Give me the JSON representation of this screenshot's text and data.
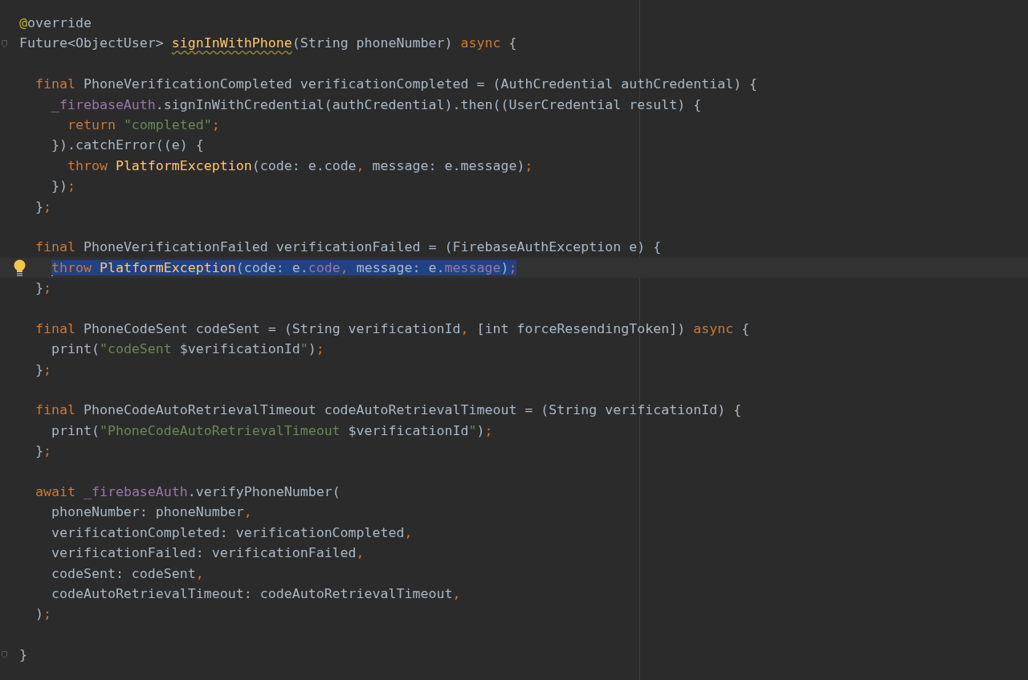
{
  "editor": {
    "lines": [
      {
        "kind": "code",
        "tokens": [
          {
            "kind": "annotation",
            "text": "@"
          },
          {
            "kind": "plain",
            "text": "override"
          }
        ]
      },
      {
        "kind": "fold",
        "tokens": [
          {
            "kind": "plain",
            "text": "Future<ObjectUser> "
          },
          {
            "kind": "warning",
            "text": "signInWithPhone"
          },
          {
            "kind": "plain",
            "text": "(String phoneNumber) "
          },
          {
            "kind": "keyword",
            "text": "async"
          },
          {
            "kind": "plain",
            "text": " {"
          }
        ]
      },
      {
        "kind": "blank"
      },
      {
        "kind": "code",
        "tokens": [
          {
            "kind": "keyword",
            "text": "  final"
          },
          {
            "kind": "plain",
            "text": " PhoneVerificationCompleted verificationCompleted = (AuthCredential authCredential) {"
          }
        ]
      },
      {
        "kind": "code",
        "tokens": [
          {
            "kind": "field",
            "text": "    _firebaseAuth"
          },
          {
            "kind": "plain",
            "text": ".signInWithCredential(authCredential).then((UserCredential result) {"
          }
        ]
      },
      {
        "kind": "code",
        "tokens": [
          {
            "kind": "keyword",
            "text": "      return "
          },
          {
            "kind": "string",
            "text": "\"completed\""
          },
          {
            "kind": "keyword",
            "text": ";"
          }
        ]
      },
      {
        "kind": "code",
        "tokens": [
          {
            "kind": "plain",
            "text": "    }).catchError((e) {"
          }
        ]
      },
      {
        "kind": "code",
        "tokens": [
          {
            "kind": "keyword",
            "text": "      throw "
          },
          {
            "kind": "declaration",
            "text": "PlatformException"
          },
          {
            "kind": "plain",
            "text": "(code: e.code"
          },
          {
            "kind": "keyword",
            "text": ","
          },
          {
            "kind": "plain",
            "text": " message: e.message)"
          },
          {
            "kind": "keyword",
            "text": ";"
          }
        ]
      },
      {
        "kind": "code",
        "tokens": [
          {
            "kind": "plain",
            "text": "    })"
          },
          {
            "kind": "keyword",
            "text": ";"
          }
        ]
      },
      {
        "kind": "code",
        "tokens": [
          {
            "kind": "plain",
            "text": "  }"
          },
          {
            "kind": "keyword",
            "text": ";"
          }
        ]
      },
      {
        "kind": "blank"
      },
      {
        "kind": "code",
        "tokens": [
          {
            "kind": "keyword",
            "text": "  final"
          },
          {
            "kind": "plain",
            "text": " PhoneVerificationFailed verificationFailed = (FirebaseAuthException e) {"
          }
        ]
      },
      {
        "kind": "active",
        "tokens": [
          {
            "kind": "keyword",
            "text": "    throw "
          },
          {
            "kind": "declaration",
            "text": "PlatformException"
          },
          {
            "kind": "plain",
            "text": "(code: e."
          },
          {
            "kind": "field",
            "text": "code"
          },
          {
            "kind": "keyword",
            "text": ","
          },
          {
            "kind": "plain",
            "text": " message: e."
          },
          {
            "kind": "field",
            "text": "message"
          },
          {
            "kind": "plain",
            "text": ")"
          },
          {
            "kind": "keyword",
            "text": ";"
          }
        ]
      },
      {
        "kind": "code",
        "tokens": [
          {
            "kind": "plain",
            "text": "  }"
          },
          {
            "kind": "keyword",
            "text": ";"
          }
        ]
      },
      {
        "kind": "blank"
      },
      {
        "kind": "code",
        "tokens": [
          {
            "kind": "keyword",
            "text": "  final"
          },
          {
            "kind": "plain",
            "text": " PhoneCodeSent codeSent = (String verificationId"
          },
          {
            "kind": "keyword",
            "text": ","
          },
          {
            "kind": "plain",
            "text": " [int forceResendingToken]) "
          },
          {
            "kind": "keyword",
            "text": "async"
          },
          {
            "kind": "plain",
            "text": " {"
          }
        ]
      },
      {
        "kind": "code",
        "tokens": [
          {
            "kind": "plain",
            "text": "    print("
          },
          {
            "kind": "string",
            "text": "\"codeSent "
          },
          {
            "kind": "plain",
            "text": "$verificationId"
          },
          {
            "kind": "string",
            "text": "\""
          },
          {
            "kind": "plain",
            "text": ")"
          },
          {
            "kind": "keyword",
            "text": ";"
          }
        ]
      },
      {
        "kind": "code",
        "tokens": [
          {
            "kind": "plain",
            "text": "  }"
          },
          {
            "kind": "keyword",
            "text": ";"
          }
        ]
      },
      {
        "kind": "blank"
      },
      {
        "kind": "code",
        "tokens": [
          {
            "kind": "keyword",
            "text": "  final"
          },
          {
            "kind": "plain",
            "text": " PhoneCodeAutoRetrievalTimeout codeAutoRetrievalTimeout = (String verificationId) {"
          }
        ]
      },
      {
        "kind": "code",
        "tokens": [
          {
            "kind": "plain",
            "text": "    print("
          },
          {
            "kind": "string",
            "text": "\"PhoneCodeAutoRetrievalTimeout "
          },
          {
            "kind": "plain",
            "text": "$verificationId"
          },
          {
            "kind": "string",
            "text": "\""
          },
          {
            "kind": "plain",
            "text": ")"
          },
          {
            "kind": "keyword",
            "text": ";"
          }
        ]
      },
      {
        "kind": "code",
        "tokens": [
          {
            "kind": "plain",
            "text": "  }"
          },
          {
            "kind": "keyword",
            "text": ";"
          }
        ]
      },
      {
        "kind": "blank"
      },
      {
        "kind": "code",
        "tokens": [
          {
            "kind": "keyword",
            "text": "  await "
          },
          {
            "kind": "field",
            "text": "_firebaseAuth"
          },
          {
            "kind": "plain",
            "text": ".verifyPhoneNumber("
          }
        ]
      },
      {
        "kind": "code",
        "tokens": [
          {
            "kind": "plain",
            "text": "    phoneNumber: phoneNumber"
          },
          {
            "kind": "keyword",
            "text": ","
          }
        ]
      },
      {
        "kind": "code",
        "tokens": [
          {
            "kind": "plain",
            "text": "    verificationCompleted: verificationCompleted"
          },
          {
            "kind": "keyword",
            "text": ","
          }
        ]
      },
      {
        "kind": "code",
        "tokens": [
          {
            "kind": "plain",
            "text": "    verificationFailed: verificationFailed"
          },
          {
            "kind": "keyword",
            "text": ","
          }
        ]
      },
      {
        "kind": "code",
        "tokens": [
          {
            "kind": "plain",
            "text": "    codeSent: codeSent"
          },
          {
            "kind": "keyword",
            "text": ","
          }
        ]
      },
      {
        "kind": "code",
        "tokens": [
          {
            "kind": "plain",
            "text": "    codeAutoRetrievalTimeout: codeAutoRetrievalTimeout"
          },
          {
            "kind": "keyword",
            "text": ","
          }
        ]
      },
      {
        "kind": "code",
        "tokens": [
          {
            "kind": "plain",
            "text": "  )"
          },
          {
            "kind": "keyword",
            "text": ";"
          }
        ]
      },
      {
        "kind": "blank"
      },
      {
        "kind": "fold",
        "tokens": [
          {
            "kind": "plain",
            "text": "}"
          }
        ]
      }
    ]
  }
}
